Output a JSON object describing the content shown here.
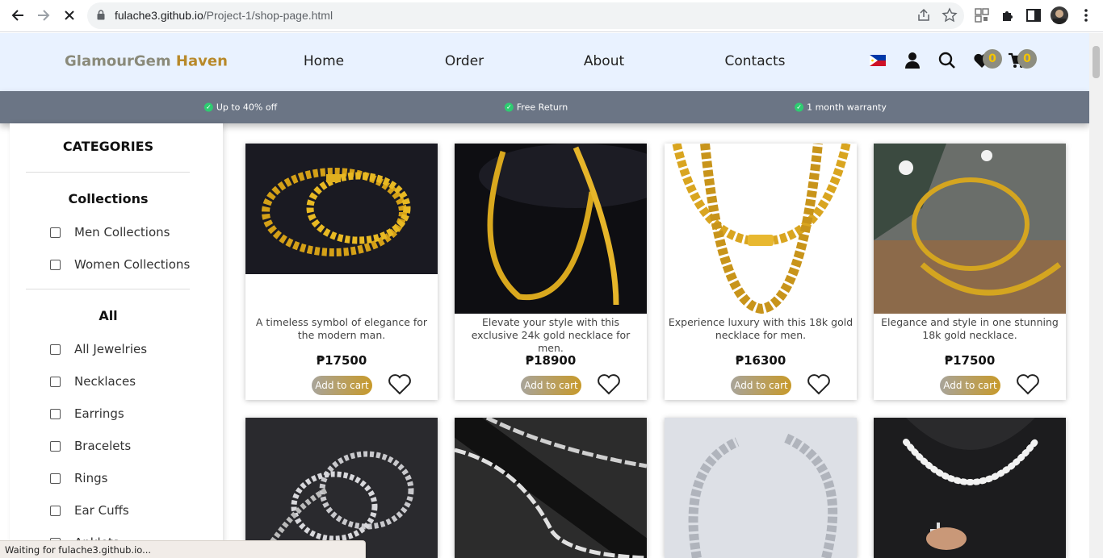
{
  "browser": {
    "url_host": "fulache3.github.io",
    "url_path": "/Project-1/shop-page.html",
    "status_text": "Waiting for fulache3.github.io..."
  },
  "header": {
    "brand_part1": "GlamourGem ",
    "brand_part2": "Haven",
    "nav": [
      "Home",
      "Order",
      "About",
      "Contacts"
    ],
    "wishlist_count": "0",
    "cart_count": "0"
  },
  "promo": [
    "Up to 40% off",
    "Free Return",
    "1 month warranty"
  ],
  "sidebar": {
    "title": "CATEGORIES",
    "collections_heading": "Collections",
    "collections": [
      "Men Collections",
      "Women Collections"
    ],
    "all_heading": "All",
    "all_items": [
      "All Jewelries",
      "Necklaces",
      "Earrings",
      "Bracelets",
      "Rings",
      "Ear Cuffs",
      "Anklets"
    ]
  },
  "products": [
    {
      "desc": "A timeless symbol of elegance for the modern man.",
      "price": "₱17500",
      "button": "Add to cart"
    },
    {
      "desc": "Elevate your style with this exclusive 24k gold necklace for men.",
      "price": "₱18900",
      "button": "Add to cart"
    },
    {
      "desc": "Experience luxury with this 18k gold necklace for men.",
      "price": "₱16300",
      "button": "Add to cart"
    },
    {
      "desc": "Elegance and style in one stunning 18k gold necklace.",
      "price": "₱17500",
      "button": "Add to cart"
    }
  ],
  "colors": {
    "header_bg": "#e9f2ff",
    "promo_bg": "#6b7585",
    "brand_gold": "#b8892a",
    "badge_text": "#f4c400"
  }
}
